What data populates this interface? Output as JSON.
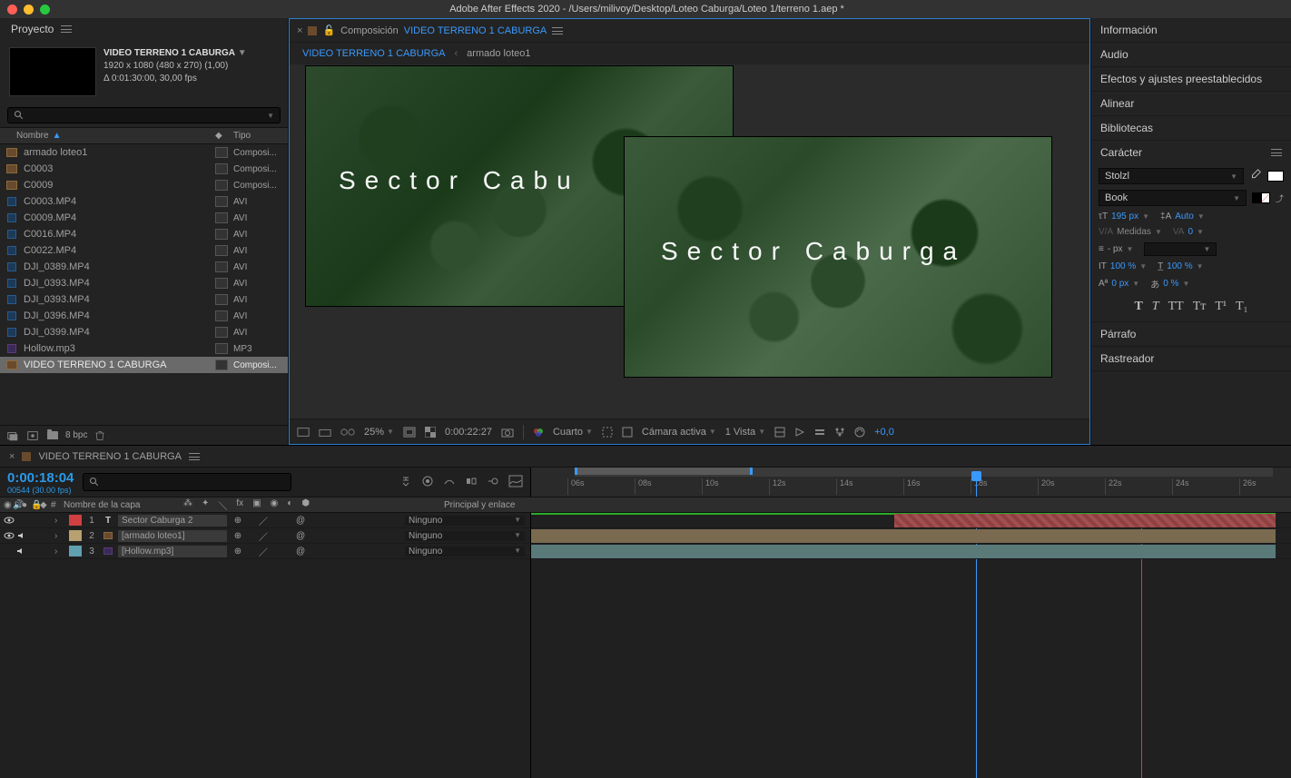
{
  "app": {
    "title": "Adobe After Effects 2020 - /Users/milivoy/Desktop/Loteo Caburga/Loteo 1/terreno 1.aep *"
  },
  "project": {
    "tab": "Proyecto",
    "comp_name": "VIDEO TERRENO 1 CABURGA",
    "dims": "1920 x 1080  (480 x 270) (1,00)",
    "dur": "Δ 0:01:30:00, 30,00 fps",
    "header_name": "Nombre",
    "header_type": "Tipo",
    "items": [
      {
        "name": "armado loteo1",
        "type": "Composi...",
        "icon": "comp"
      },
      {
        "name": "C0003",
        "type": "Composi...",
        "icon": "comp"
      },
      {
        "name": "C0009",
        "type": "Composi...",
        "icon": "comp"
      },
      {
        "name": "C0003.MP4",
        "type": "AVI",
        "icon": "vid"
      },
      {
        "name": "C0009.MP4",
        "type": "AVI",
        "icon": "vid"
      },
      {
        "name": "C0016.MP4",
        "type": "AVI",
        "icon": "vid"
      },
      {
        "name": "C0022.MP4",
        "type": "AVI",
        "icon": "vid"
      },
      {
        "name": "DJI_0389.MP4",
        "type": "AVI",
        "icon": "vid"
      },
      {
        "name": "DJI_0393.MP4",
        "type": "AVI",
        "icon": "vid"
      },
      {
        "name": "DJI_0393.MP4",
        "type": "AVI",
        "icon": "vid"
      },
      {
        "name": "DJI_0396.MP4",
        "type": "AVI",
        "icon": "vid"
      },
      {
        "name": "DJI_0399.MP4",
        "type": "AVI",
        "icon": "vid"
      },
      {
        "name": "Hollow.mp3",
        "type": "MP3",
        "icon": "aud"
      },
      {
        "name": "VIDEO TERRENO 1 CABURGA",
        "type": "Composi...",
        "icon": "comp",
        "sel": true
      }
    ],
    "footer": {
      "bpc": "8 bpc"
    }
  },
  "viewer": {
    "tab_prefix": "Composición",
    "tab_name": "VIDEO TERRENO 1 CABURGA",
    "crumb1": "VIDEO TERRENO 1 CABURGA",
    "crumb2": "armado loteo1",
    "text_layer": "Sector Caburga",
    "text_crop": "Sector Cabu",
    "footer": {
      "zoom": "25%",
      "time": "0:00:22:27",
      "quality": "Cuarto",
      "camera": "Cámara activa",
      "views": "1 Vista",
      "exposure": "+0,0"
    }
  },
  "right_panels": {
    "info": "Información",
    "audio": "Audio",
    "effects": "Efectos y ajustes preestablecidos",
    "align": "Alinear",
    "libraries": "Bibliotecas",
    "character": "Carácter",
    "paragraph": "Párrafo",
    "tracker": "Rastreador"
  },
  "character": {
    "font": "Stolzl",
    "style": "Book",
    "size": "195 px",
    "leading": "Auto",
    "metrics_lbl": "Medidas",
    "tracking": "0",
    "stroke": "- px",
    "vscale": "100 %",
    "hscale": "100 %",
    "baseline": "0 px",
    "tsume": "0 %",
    "fill": "#ffffff",
    "stroke_color": "#000000"
  },
  "timeline": {
    "tab": "VIDEO TERRENO 1 CABURGA",
    "timecode": "0:00:18:04",
    "frame_sub": "00544 (30.00 fps)",
    "col_layer": "Nombre de la capa",
    "col_parent": "Principal y enlace",
    "layers": [
      {
        "num": "1",
        "name": "Sector Caburga 2",
        "color": "#d04040",
        "icon": "T",
        "parent": "Ninguno",
        "eye": true,
        "speaker": false
      },
      {
        "num": "2",
        "name": "[armado loteo1]",
        "color": "#b8a070",
        "icon": "comp",
        "parent": "Ninguno",
        "eye": true,
        "speaker": true
      },
      {
        "num": "3",
        "name": "[Hollow.mp3]",
        "color": "#60a0b0",
        "icon": "aud",
        "parent": "Ninguno",
        "eye": false,
        "speaker": true
      }
    ],
    "ticks": [
      "06s",
      "08s",
      "10s",
      "12s",
      "14s",
      "16s",
      "18s",
      "20s",
      "22s",
      "24s",
      "26s"
    ],
    "parent_none": "Ninguno"
  }
}
